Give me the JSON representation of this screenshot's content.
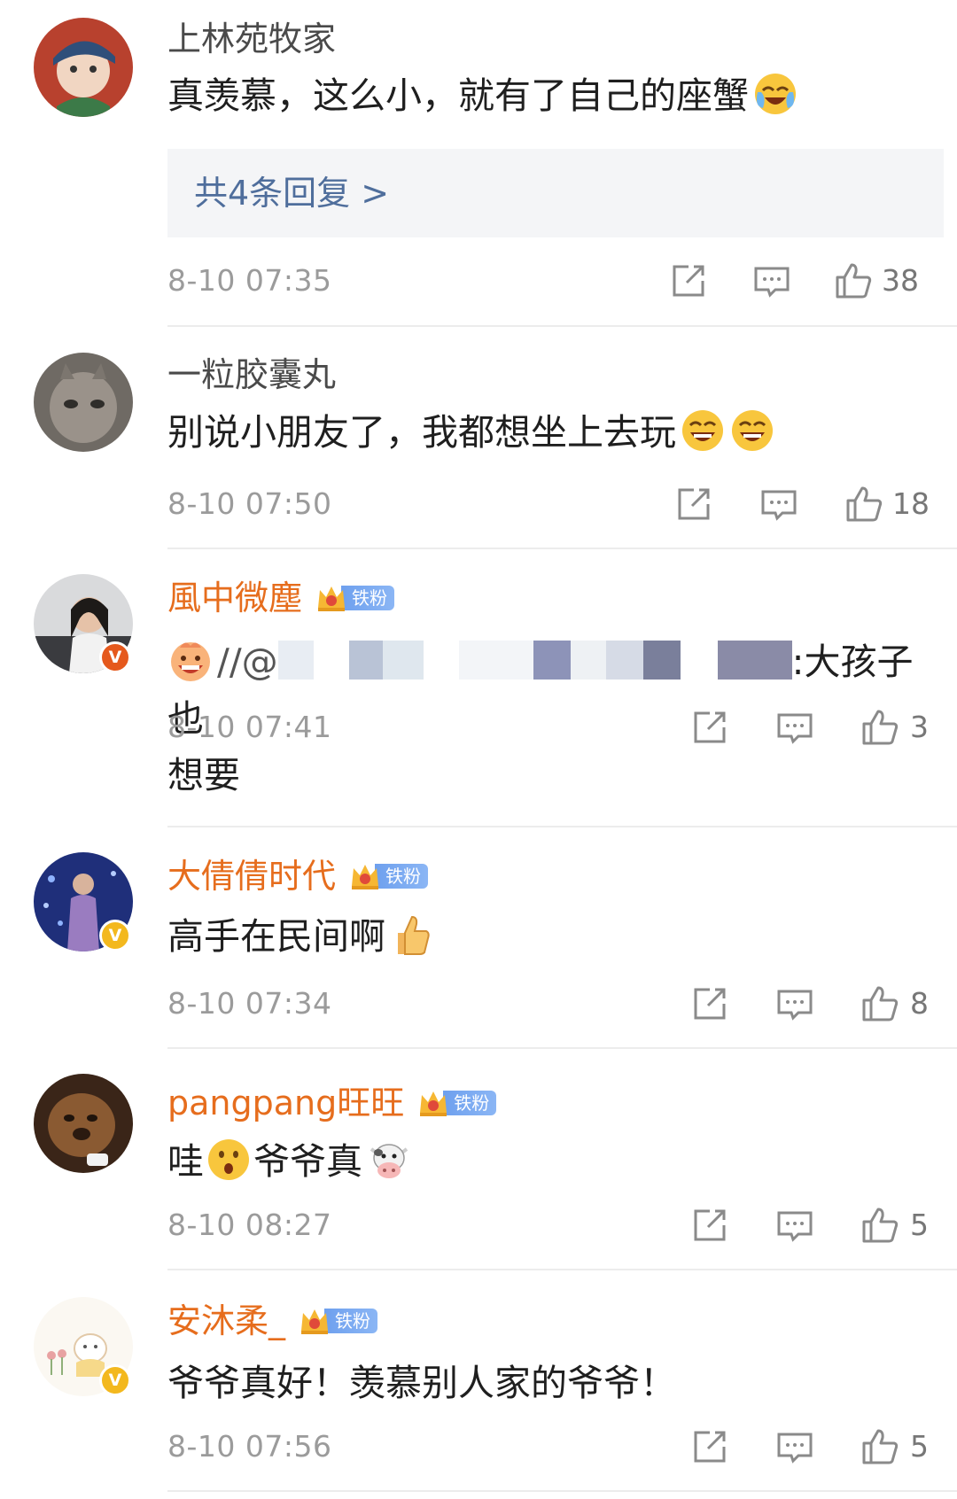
{
  "comments": [
    {
      "username": "上林苑牧家",
      "text": "真羡慕，这么小，就有了自己的座蟹",
      "emojis": [
        "crying-laugh-emoji"
      ],
      "replies_label": "共4条回复 >",
      "time": "8-10 07:35",
      "likes": "38",
      "verified": false,
      "fan_badge": null
    },
    {
      "username": "一粒胶囊丸",
      "text": "别说小朋友了，我都想坐上去玩",
      "emojis": [
        "laugh-emoji",
        "laugh-emoji"
      ],
      "time": "8-10 07:50",
      "likes": "18",
      "verified": false,
      "fan_badge": null
    },
    {
      "username": "風中微塵",
      "text_prefix": "//@",
      "text_suffix": ":大孩子也",
      "text_line2": "想要",
      "emojis": [
        "grinning-face-emoji"
      ],
      "time": "8-10 07:41",
      "likes": "3",
      "verified": true,
      "verified_color": "#e5591d",
      "fan_badge": "铁粉"
    },
    {
      "username": "大倩倩时代",
      "text": "高手在民间啊",
      "emojis": [
        "thumbs-up-emoji"
      ],
      "time": "8-10 07:34",
      "likes": "8",
      "verified": true,
      "verified_color": "#f3b81e",
      "fan_badge": "铁粉"
    },
    {
      "username": "pangpang旺旺",
      "text_a": "哇",
      "text_b": "爷爷真",
      "emojis": [
        "surprised-emoji",
        "cow-emoji"
      ],
      "time": "8-10 08:27",
      "likes": "5",
      "verified": false,
      "fan_badge": "铁粉"
    },
    {
      "username": "安沐柔_",
      "text": "爷爷真好！羡慕别人家的爷爷！",
      "time": "8-10 07:56",
      "likes": "5",
      "verified": true,
      "verified_color": "#f3b81e",
      "fan_badge": "铁粉"
    }
  ],
  "icons": {
    "share": "share-icon",
    "comment": "comment-icon",
    "like": "like-icon"
  },
  "colors": {
    "fan_username": "#e66d1d",
    "reply_link": "#4f6e9c",
    "meta_gray": "#9b9b9b"
  }
}
